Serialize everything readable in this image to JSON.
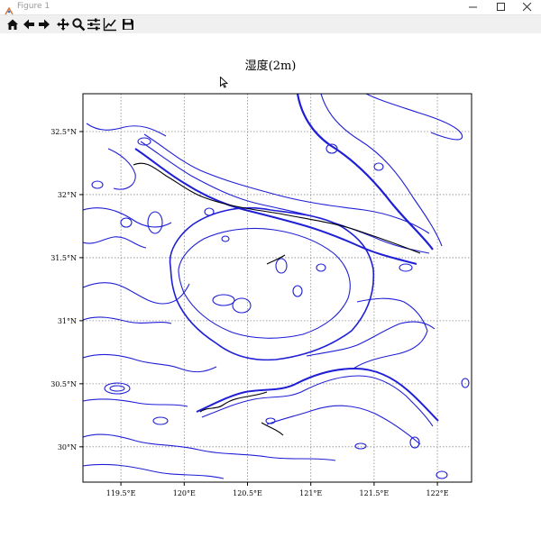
{
  "window": {
    "title": "Figure 1",
    "controls": [
      "minimize-icon",
      "maximize-icon",
      "close-icon"
    ]
  },
  "toolbar": {
    "tools": [
      "home-icon",
      "back-arrow-icon",
      "forward-arrow-icon",
      "pan-icon",
      "zoom-icon",
      "subplots-icon",
      "edit-axis-icon",
      "save-icon"
    ]
  },
  "figure": {
    "title": "湿度(2m)"
  },
  "chart_data": {
    "type": "contour map",
    "title": "湿度(2m)",
    "x_ticks": [
      "119.5°E",
      "120°E",
      "120.5°E",
      "121°E",
      "121.5°E",
      "122°E"
    ],
    "x_tick_values": [
      119.5,
      120.0,
      120.5,
      121.0,
      121.5,
      122.0
    ],
    "y_ticks": [
      "32.5°N",
      "32°N",
      "31.5°N",
      "31°N",
      "30.5°N",
      "30°N"
    ],
    "y_tick_values": [
      32.5,
      32.0,
      31.5,
      31.0,
      30.5,
      30.0
    ],
    "xlim": [
      119.2,
      122.27
    ],
    "ylim": [
      29.72,
      32.8
    ],
    "grid": true,
    "colors": {
      "contour": "#1f1fd6",
      "coastline": "#000000",
      "grid": "#888888"
    }
  }
}
